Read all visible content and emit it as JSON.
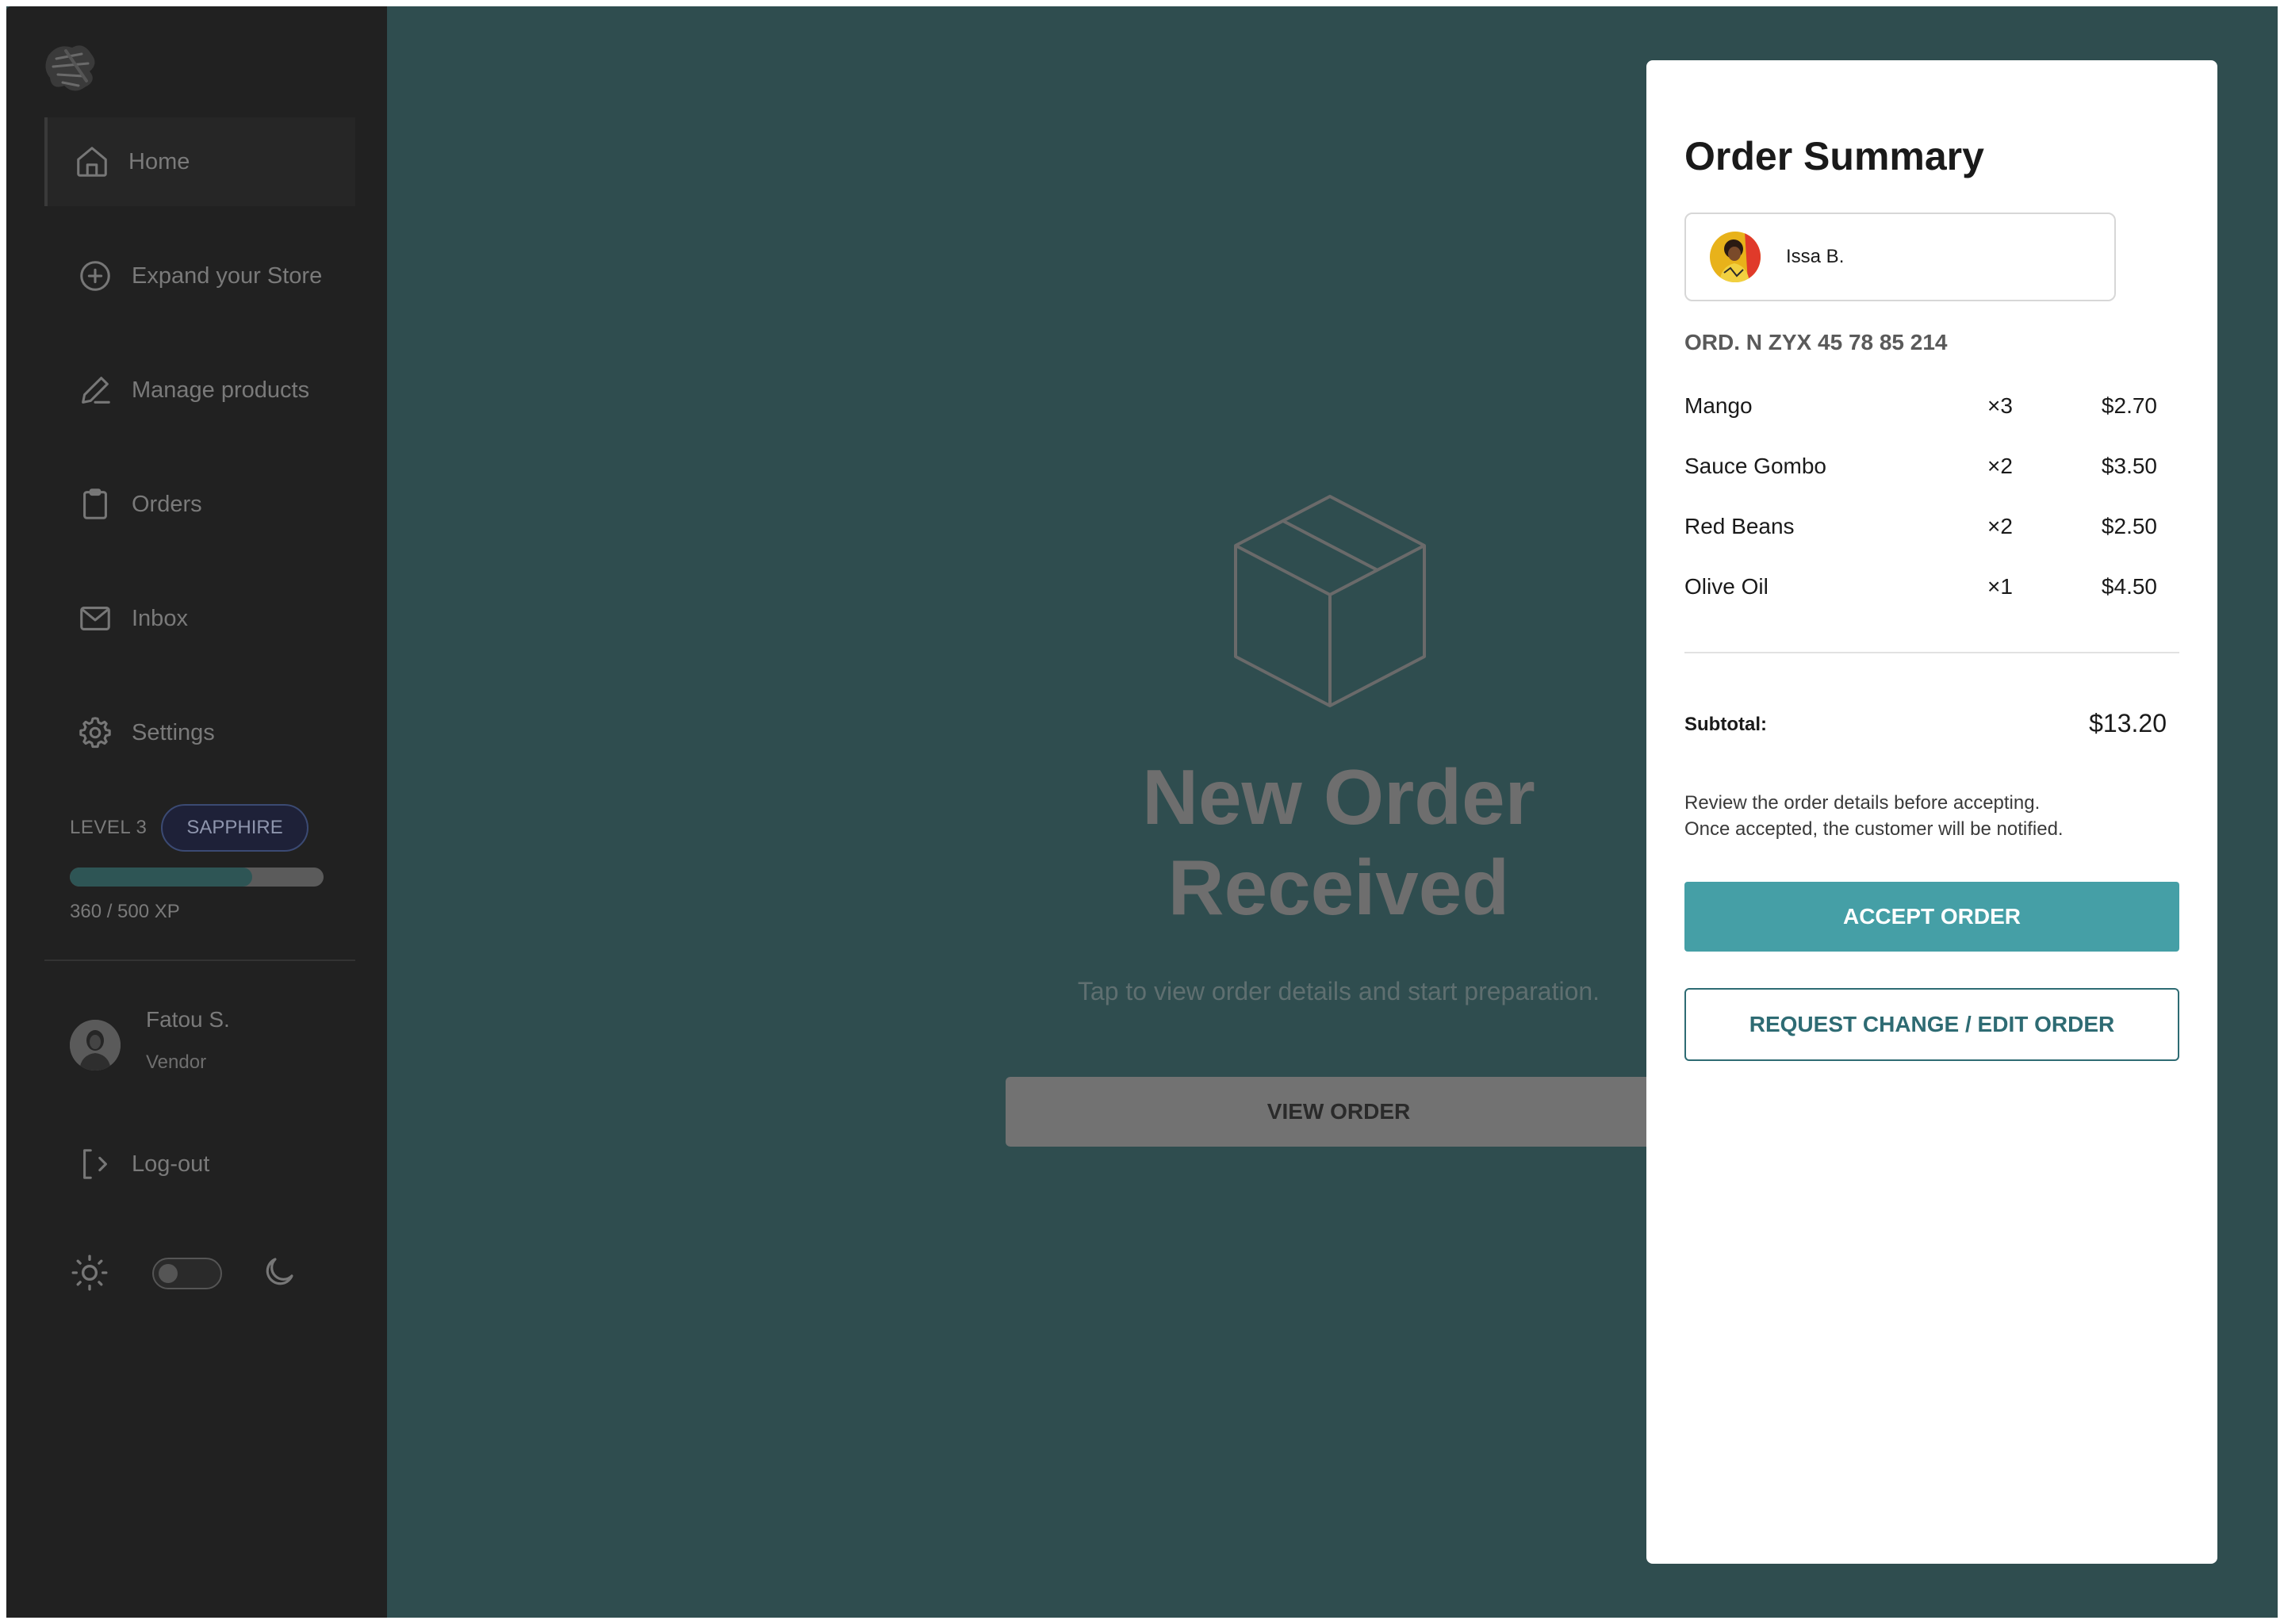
{
  "sidebar": {
    "logo_icon": "brush-splash-logo",
    "nav": [
      {
        "label": "Home",
        "icon": "home-icon",
        "active": true
      },
      {
        "label": "Expand your Store",
        "icon": "plus-circle-icon",
        "active": false
      },
      {
        "label": "Manage products",
        "icon": "pen-icon",
        "active": false
      },
      {
        "label": "Orders",
        "icon": "clipboard-icon",
        "active": false
      },
      {
        "label": "Inbox",
        "icon": "mail-icon",
        "active": false
      },
      {
        "label": "Settings",
        "icon": "gear-icon",
        "active": false
      }
    ],
    "level": {
      "label": "LEVEL 3",
      "badge": "SAPPHIRE",
      "xp_text": "360 / 500 XP",
      "xp_fraction": 0.72
    },
    "user": {
      "name": "Fatou S.",
      "role": "Vendor"
    },
    "logout_label": "Log-out",
    "theme": {
      "sun_icon": "sun-icon",
      "moon_icon": "moon-icon",
      "dark_mode": false
    }
  },
  "main": {
    "icon": "box-icon",
    "headline_line1": "New Order",
    "headline_line2": "Received",
    "subline": "Tap to view order details and start preparation.",
    "view_button": "VIEW ORDER"
  },
  "order_summary": {
    "title": "Order Summary",
    "customer_name": "Issa B.",
    "order_number": "ORD. N ZYX 45 78 85 214",
    "items": [
      {
        "name": "Mango",
        "qty": "×3",
        "price": "$2.70"
      },
      {
        "name": "Sauce Gombo",
        "qty": "×2",
        "price": "$3.50"
      },
      {
        "name": "Red Beans",
        "qty": "×2",
        "price": "$2.50"
      },
      {
        "name": "Olive Oil",
        "qty": "×1",
        "price": "$4.50"
      }
    ],
    "subtotal_label": "Subtotal:",
    "subtotal_value": "$13.20",
    "note_line1": "Review the order details before accepting.",
    "note_line2": "Once accepted, the customer will be notified.",
    "accept_button": "ACCEPT ORDER",
    "request_button": "REQUEST CHANGE / EDIT ORDER"
  },
  "colors": {
    "backdrop": "#2f4d4f",
    "sidebar": "#212121",
    "accent": "#459fa6",
    "outline_button": "#2e6b73"
  }
}
